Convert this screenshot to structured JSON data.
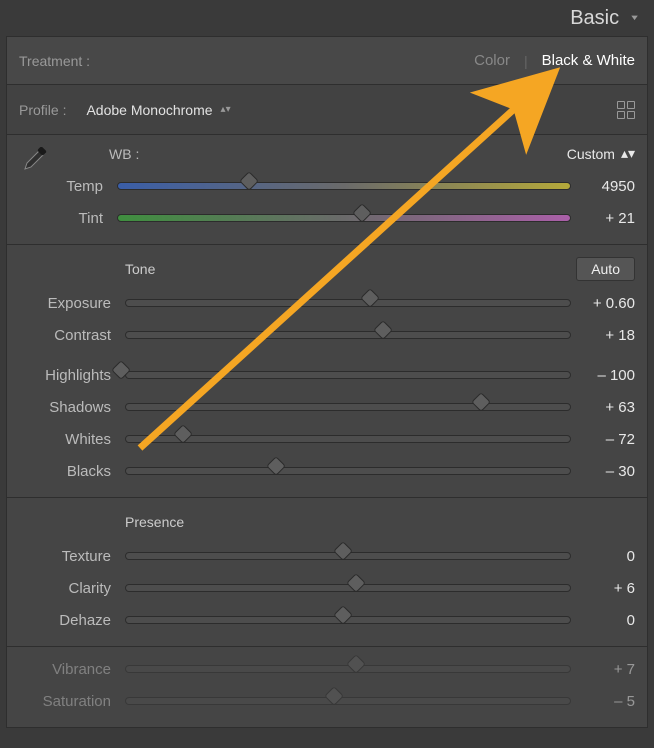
{
  "panel": {
    "title": "Basic"
  },
  "treatment": {
    "label": "Treatment :",
    "color_label": "Color",
    "bw_label": "Black & White",
    "active": "bw"
  },
  "profile": {
    "label": "Profile :",
    "value": "Adobe Monochrome"
  },
  "wb": {
    "label": "WB :",
    "value": "Custom",
    "temp": {
      "label": "Temp",
      "value": "4950",
      "pos": 30
    },
    "tint": {
      "label": "Tint",
      "value": "+ 21",
      "pos": 55
    }
  },
  "tone": {
    "header": "Tone",
    "auto_label": "Auto",
    "exposure": {
      "label": "Exposure",
      "value": "+ 0.60",
      "pos": 56
    },
    "contrast": {
      "label": "Contrast",
      "value": "+ 18",
      "pos": 59
    },
    "highlights": {
      "label": "Highlights",
      "value": "– 100",
      "pos": 0
    },
    "shadows": {
      "label": "Shadows",
      "value": "+ 63",
      "pos": 81
    },
    "whites": {
      "label": "Whites",
      "value": "– 72",
      "pos": 14
    },
    "blacks": {
      "label": "Blacks",
      "value": "– 30",
      "pos": 35
    }
  },
  "presence": {
    "header": "Presence",
    "texture": {
      "label": "Texture",
      "value": "0",
      "pos": 50
    },
    "clarity": {
      "label": "Clarity",
      "value": "+ 6",
      "pos": 53
    },
    "dehaze": {
      "label": "Dehaze",
      "value": "0",
      "pos": 50
    }
  },
  "sat": {
    "vibrance": {
      "label": "Vibrance",
      "value": "+ 7",
      "pos": 53
    },
    "saturation": {
      "label": "Saturation",
      "value": "– 5",
      "pos": 48
    }
  },
  "annotation": {
    "arrow_color": "#f5a623"
  }
}
